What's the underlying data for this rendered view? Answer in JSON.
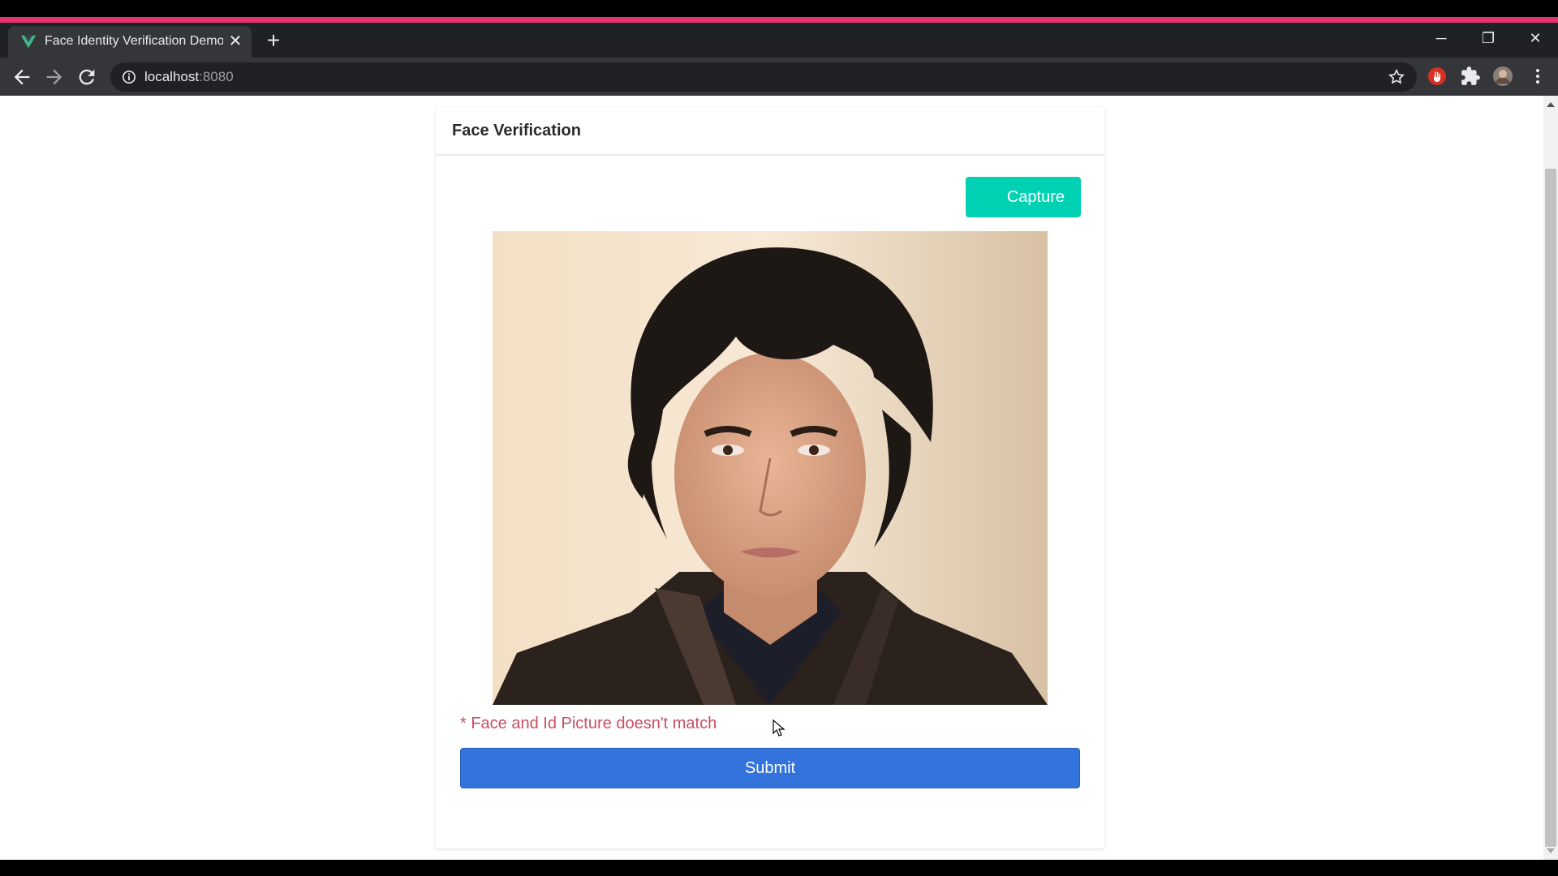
{
  "browser": {
    "tab_title": "Face Identity Verification Demo",
    "tab_close_glyph": "✕",
    "new_tab_glyph": "+",
    "url_host": "localhost",
    "url_port": ":8080",
    "accent_color": "#e6336f",
    "window_controls": {
      "minimize": "─",
      "restore": "❐",
      "close": "✕"
    }
  },
  "page": {
    "card_title": "Face Verification",
    "capture_label": "Capture",
    "error_message": "* Face and Id Picture doesn't match",
    "submit_label": "Submit",
    "colors": {
      "capture": "#00d1b2",
      "submit": "#3273dc",
      "error": "#c94f62"
    }
  },
  "icons": {
    "favicon": "vue-logo-icon",
    "back": "back-arrow-icon",
    "forward": "forward-arrow-icon",
    "reload": "reload-icon",
    "info": "info-icon",
    "bookmark": "star-icon",
    "extension_1": "red-extension-icon",
    "extension_2": "puzzle-icon",
    "profile": "profile-avatar",
    "menu": "kebab-menu-icon"
  }
}
